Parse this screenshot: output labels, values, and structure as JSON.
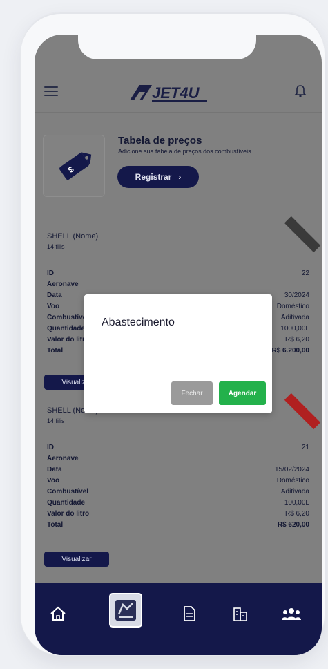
{
  "header": {
    "logo_text": "JET4U"
  },
  "price_table": {
    "title": "Tabela de preços",
    "subtitle": "Adicione sua tabela de preços dos combustíveis",
    "register_label": "Registrar"
  },
  "records": [
    {
      "name": "SHELL (Nome)",
      "sub": "14 filis",
      "ribbon_color": "#3a3a3a",
      "rows": [
        {
          "k": "ID",
          "v": "22"
        },
        {
          "k": "Aeronave",
          "v": ""
        },
        {
          "k": "Data",
          "v": "30/2024"
        },
        {
          "k": "Voo",
          "v": "Doméstico"
        },
        {
          "k": "Combustível",
          "v": "Aditivada"
        },
        {
          "k": "Quantidade",
          "v": "1000,00L"
        },
        {
          "k": "Valor do litro",
          "v": "R$ 6,20"
        },
        {
          "k": "Total",
          "v": "R$ 6.200,00"
        }
      ],
      "view_label": "Visualizar"
    },
    {
      "name": "SHELL (Nome)",
      "sub": "14 filis",
      "ribbon_color": "#b02020",
      "rows": [
        {
          "k": "ID",
          "v": "21"
        },
        {
          "k": "Aeronave",
          "v": ""
        },
        {
          "k": "Data",
          "v": "15/02/2024"
        },
        {
          "k": "Voo",
          "v": "Doméstico"
        },
        {
          "k": "Combustível",
          "v": "Aditivada"
        },
        {
          "k": "Quantidade",
          "v": "100,00L"
        },
        {
          "k": "Valor do litro",
          "v": "R$ 6,20"
        },
        {
          "k": "Total",
          "v": "R$ 620,00"
        }
      ],
      "view_label": "Visualizar"
    }
  ],
  "modal": {
    "title": "Abastecimento",
    "close_label": "Fechar",
    "schedule_label": "Agendar"
  },
  "bottom_nav": {
    "items": [
      {
        "icon": "home-icon"
      },
      {
        "icon": "fuel-icon"
      },
      {
        "icon": "document-icon"
      },
      {
        "icon": "buildings-icon"
      },
      {
        "icon": "users-icon"
      }
    ]
  },
  "colors": {
    "navy": "#14184a",
    "accent_green": "#23b14b",
    "close_gray": "#9a9a9a"
  }
}
